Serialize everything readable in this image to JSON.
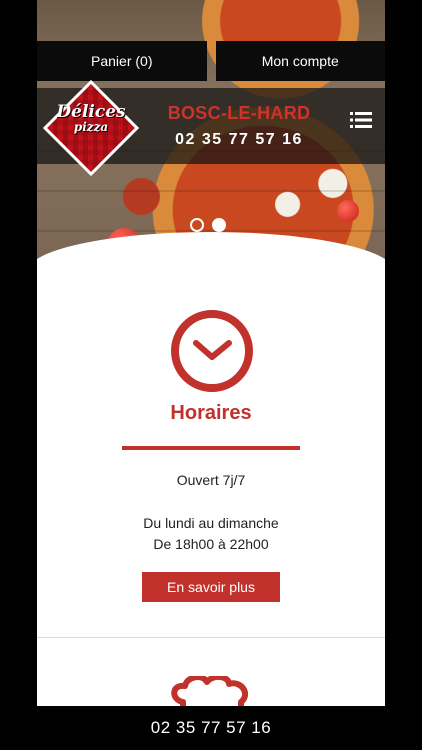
{
  "topnav": {
    "cart_label": "Panier (0)",
    "account_label": "Mon compte"
  },
  "brand": {
    "logo_main": "Délices",
    "logo_sub": "pizza",
    "city": "BOSC-LE-HARD",
    "phone": "02 35 77 57 16"
  },
  "carousel": {
    "slides": 2,
    "active_index": 1
  },
  "hours": {
    "title": "Horaires",
    "line1": "Ouvert 7j/7",
    "line2": "Du lundi au dimanche",
    "line3": "De 18h00 à 22h00",
    "button_label": "En savoir plus"
  },
  "footer": {
    "phone": "02 35 77 57 16"
  },
  "colors": {
    "accent": "#c0322b",
    "dark": "#0b0b0b"
  },
  "icons": {
    "menu": "list-icon",
    "hours": "clock-icon",
    "next_section": "chef-hat-icon"
  }
}
